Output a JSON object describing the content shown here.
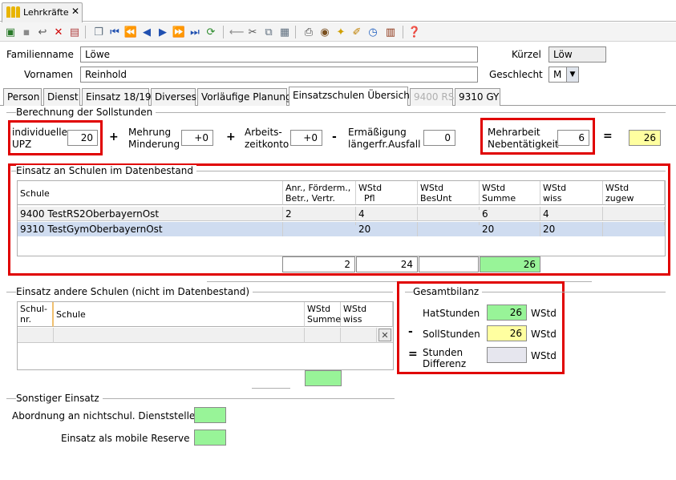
{
  "window": {
    "tab_title": "Lehrkräfte",
    "close": "✕"
  },
  "toolbar": {
    "icons": [
      "new-record-icon",
      "save-icon",
      "undo-icon",
      "delete-icon",
      "cancel-edit-icon",
      "copy-record-icon",
      "first-icon",
      "prev-page-icon",
      "prev-icon",
      "next-icon",
      "next-page-icon",
      "last-icon",
      "refresh-icon",
      "back-arrow-icon",
      "cut-icon",
      "copy-icon",
      "paste-icon",
      "print-icon",
      "preview-icon",
      "hint-icon",
      "broom-icon",
      "clock-icon",
      "report-icon",
      "help-icon"
    ]
  },
  "person": {
    "familienname_label": "Familienname",
    "familienname": "Löwe",
    "vorname_label": "Vornamen",
    "vorname": "Reinhold",
    "kuerzel_label": "Kürzel",
    "kuerzel": "Löw",
    "geschlecht_label": "Geschlecht",
    "geschlecht": "M"
  },
  "tabs": [
    "Person",
    "Dienst",
    "Einsatz 18/19",
    "Diverses",
    "Vorläufige Planung",
    "Einsatzschulen Übersicht",
    "9400 RS",
    "9310 GY"
  ],
  "soll": {
    "section": "Berechnung der Sollstunden",
    "upz_l1": "individuelle",
    "upz_l2": "UPZ",
    "upz": "20",
    "mehr_l1": "Mehrung",
    "mehr_l2": "Minderung",
    "mehr": "+0",
    "arb_l1": "Arbeits-",
    "arb_l2": "zeitkonto",
    "arb": "+0",
    "erm_l1": "Ermäßigung",
    "erm_l2": "längerfr.Ausfall",
    "erm": "0",
    "mn_l1": "Mehrarbeit",
    "mn_l2": "Nebentätigkeit",
    "mn": "6",
    "plus": "+",
    "minus": "-",
    "eq": "=",
    "result": "26"
  },
  "einsatz": {
    "section": "Einsatz an Schulen im Datenbestand",
    "headers": [
      {
        "l1": "Schule",
        "l2": ""
      },
      {
        "l1": "Anr., Förderm.,",
        "l2": "Betr., Vertr."
      },
      {
        "l1": "WStd",
        "l2": "Pfl"
      },
      {
        "l1": "WStd",
        "l2": "BesUnt"
      },
      {
        "l1": "WStd",
        "l2": "Summe"
      },
      {
        "l1": "WStd",
        "l2": "wiss"
      },
      {
        "l1": "WStd",
        "l2": "zugew"
      }
    ],
    "rows": [
      [
        "9400 TestRS2OberbayernOst",
        "2",
        "4",
        "",
        "6",
        "4",
        ""
      ],
      [
        "9310 TestGymOberbayernOst",
        "",
        "20",
        "",
        "20",
        "20",
        ""
      ]
    ],
    "totals": [
      "2",
      "24",
      "",
      "26"
    ]
  },
  "andere": {
    "section": "Einsatz andere Schulen (nicht im Datenbestand)",
    "h_nr_1": "Schul-",
    "h_nr_2": "nr.",
    "h_schule": "Schule",
    "h_sum_1": "WStd",
    "h_sum_2": "Summe",
    "h_wiss_1": "WStd",
    "h_wiss_2": "wiss",
    "delete": "✕"
  },
  "gesamt": {
    "section": "Gesamtbilanz",
    "hat_label": "HatStunden",
    "hat": "26",
    "unit": "WStd",
    "soll_label": "SollStunden",
    "soll": "26",
    "minus": "-",
    "eq": "=",
    "diff_l1": "Stunden",
    "diff_l2": "Differenz",
    "diff": ""
  },
  "sonstig": {
    "section": "Sonstiger Einsatz",
    "abordnung": "Abordnung an nichtschul. Dienststelle",
    "mobile": "Einsatz als mobile Reserve"
  },
  "colors": {
    "highlight": "#e00000",
    "green": "#98f498",
    "yellow": "#ffffa0",
    "selection": "#cfdcf0"
  }
}
